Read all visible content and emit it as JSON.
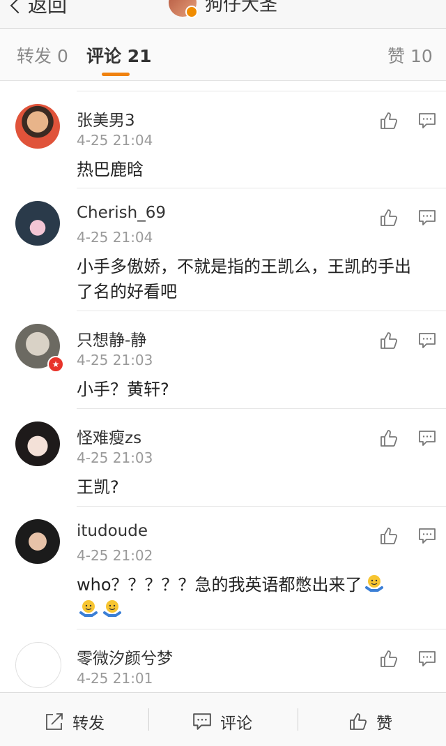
{
  "nav": {
    "back_label": "返回",
    "title": "狗仔大圣"
  },
  "tabs": {
    "repost": "转发 0",
    "comment": "评论 21",
    "like": "赞 10"
  },
  "comments": [
    {
      "name": "张美男3",
      "time": "4-25 21:04",
      "text": "热巴鹿晗"
    },
    {
      "name": "Cherish_69",
      "time": "4-25 21:04",
      "text": "小手多傲娇，不就是指的王凯么，王凯的手出了名的好看吧"
    },
    {
      "name": "只想静-静",
      "time": "4-25 21:03",
      "text": "小手？黄轩?"
    },
    {
      "name": "怪难瘦zs",
      "time": "4-25 21:03",
      "text": "王凯?"
    },
    {
      "name": "itudoude",
      "time": "4-25 21:02",
      "text": "who？？？？？急的我英语都憋出来了"
    },
    {
      "name": "零微汐颜兮梦",
      "time": "4-25 21:01",
      "text": ""
    }
  ],
  "bottom": {
    "repost": "转发",
    "comment": "评论",
    "like": "赞"
  },
  "colors": {
    "accent": "#f0820f",
    "vip_badge": "#e8332a"
  }
}
